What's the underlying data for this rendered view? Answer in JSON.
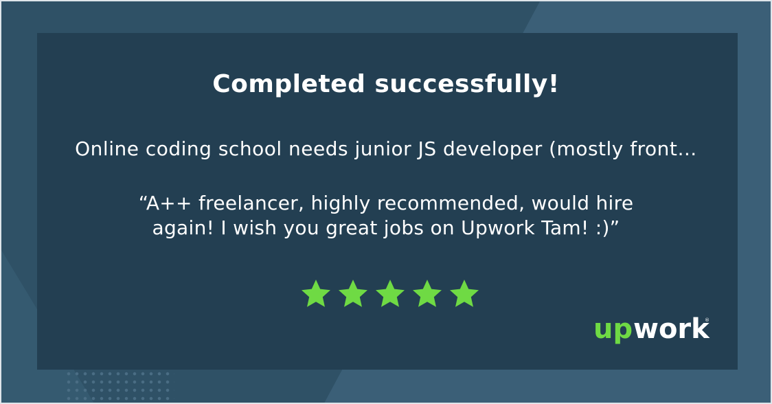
{
  "title": "Completed successfully!",
  "job_title": "Online coding school needs junior JS developer (mostly front…",
  "review": {
    "line1": "“A++ freelancer, highly recommended, would hire",
    "line2": "again! I wish you great jobs on Upwork Tam! :)”"
  },
  "rating": {
    "value": 5,
    "max": 5
  },
  "brand": {
    "logo_text": "upwork",
    "colors": {
      "accent": "#6fda44",
      "background": "#233f52",
      "text": "#ffffff"
    }
  },
  "icons": {
    "star": "star-icon",
    "logo": "upwork-logo"
  }
}
